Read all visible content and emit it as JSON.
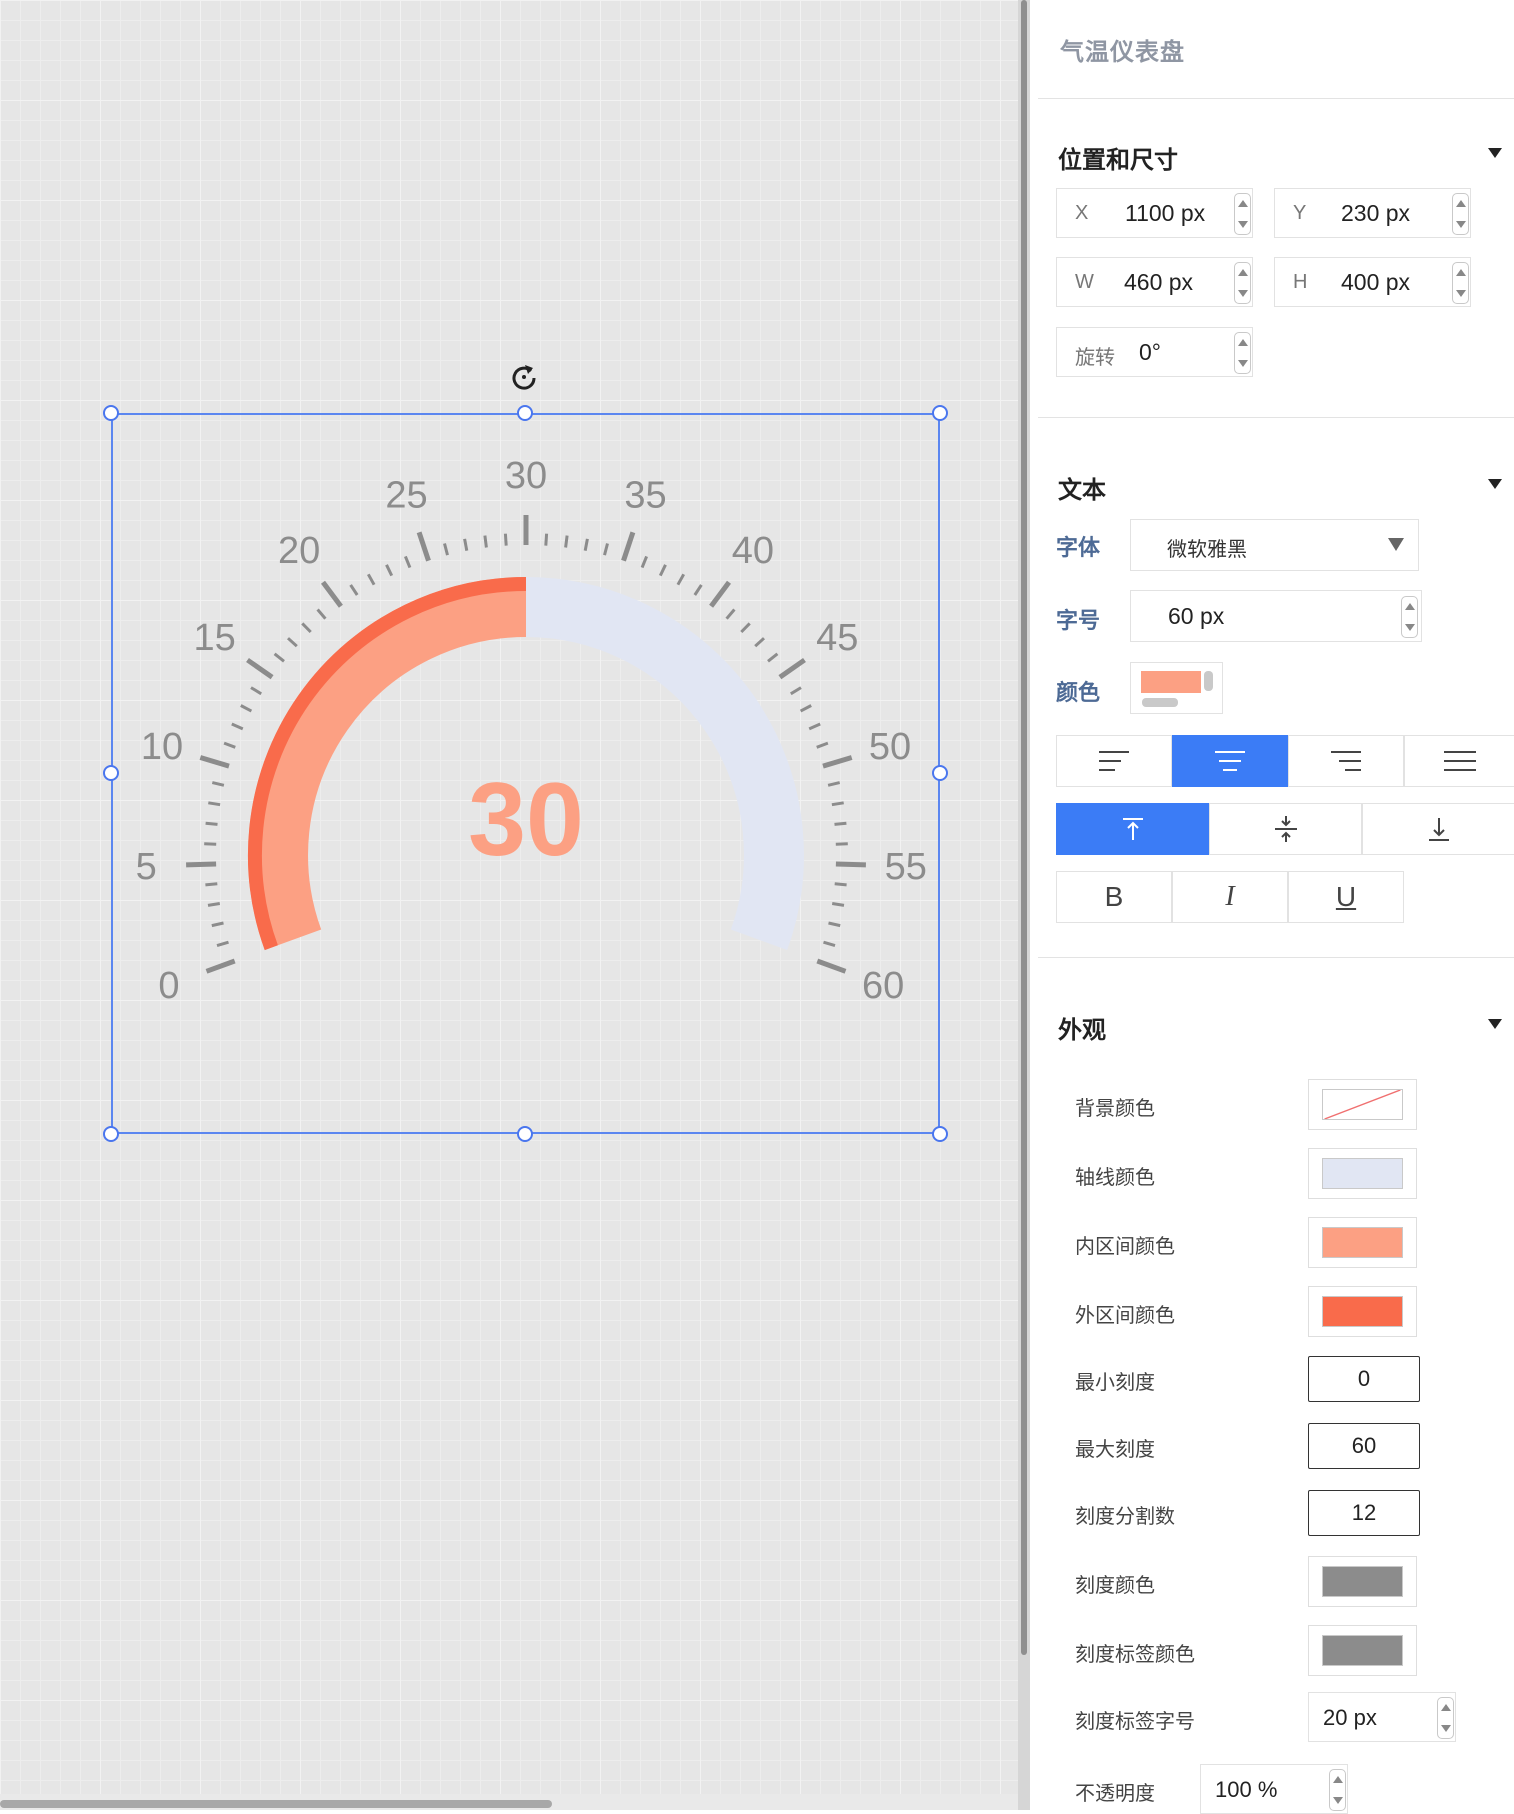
{
  "gauge": {
    "min": 0,
    "max": 60,
    "divisions": 12,
    "value": 30,
    "tick_labels": [
      "0",
      "5",
      "10",
      "15",
      "20",
      "25",
      "30",
      "35",
      "40",
      "45",
      "50",
      "55",
      "60"
    ],
    "value_text": "30",
    "colors": {
      "axis": "#e1e6f3",
      "inner": "#fca083",
      "outer": "#f96b4b",
      "tick": "#8c8c8c",
      "tick_label": "#8c8c8c",
      "value": "#fca083"
    }
  },
  "panel": {
    "title": "气温仪表盘",
    "position": {
      "title": "位置和尺寸",
      "x_label": "X",
      "x_value": "1100 px",
      "y_label": "Y",
      "y_value": "230 px",
      "w_label": "W",
      "w_value": "460 px",
      "h_label": "H",
      "h_value": "400 px",
      "rot_label": "旋转",
      "rot_value": "0°"
    },
    "text": {
      "title": "文本",
      "font_label": "字体",
      "font_value": "微软雅黑",
      "size_label": "字号",
      "size_value": "60 px",
      "color_label": "颜色",
      "color_value": "#fca083",
      "bold": "B",
      "italic": "I",
      "underline": "U"
    },
    "appearance": {
      "title": "外观",
      "bg_label": "背景颜色",
      "axis_label": "轴线颜色",
      "axis_color": "#e1e6f3",
      "inner_label": "内区间颜色",
      "inner_color": "#fca083",
      "outer_label": "外区间颜色",
      "outer_color": "#f96b4b",
      "min_label": "最小刻度",
      "min_value": "0",
      "max_label": "最大刻度",
      "max_value": "60",
      "div_label": "刻度分割数",
      "div_value": "12",
      "tick_color_label": "刻度颜色",
      "tick_color": "#8c8c8c",
      "tick_label_color_label": "刻度标签颜色",
      "tick_label_color": "#8c8c8c",
      "tick_font_label": "刻度标签字号",
      "tick_font_value": "20 px",
      "opacity_label": "不透明度",
      "opacity_value": "100 %"
    }
  }
}
